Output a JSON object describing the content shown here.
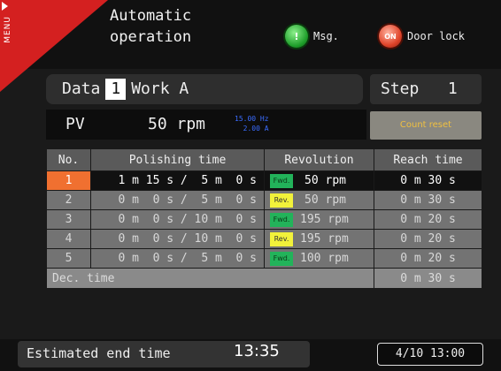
{
  "header": {
    "menu_label": "MENU",
    "title": "Automatic\noperation",
    "msg_button": {
      "icon": "!",
      "label": "Msg."
    },
    "door_button": {
      "icon": "ON",
      "label": "Door lock"
    }
  },
  "data_row": {
    "data_label": "Data",
    "data_number": "1",
    "work_label": "Work A"
  },
  "step": {
    "label": "Step",
    "value": "1"
  },
  "pv": {
    "label": "PV",
    "value": "50 rpm",
    "sub_line1": "15.00 Hz",
    "sub_line2": "2.00 A"
  },
  "count_reset_label": "Count reset",
  "table": {
    "headers": [
      "No.",
      "Polishing time",
      "Revolution",
      "Reach time"
    ],
    "rows": [
      {
        "no": "1",
        "polishing": "1 m 15 s /  5 m  0 s",
        "dir": "Fwd.",
        "rev": "50 rpm",
        "reach": "0 m 30 s"
      },
      {
        "no": "2",
        "polishing": "0 m  0 s /  5 m  0 s",
        "dir": "Rev.",
        "rev": "50 rpm",
        "reach": "0 m 30 s"
      },
      {
        "no": "3",
        "polishing": "0 m  0 s / 10 m  0 s",
        "dir": "Fwd.",
        "rev": "195 rpm",
        "reach": "0 m 20 s"
      },
      {
        "no": "4",
        "polishing": "0 m  0 s / 10 m  0 s",
        "dir": "Rev.",
        "rev": "195 rpm",
        "reach": "0 m 20 s"
      },
      {
        "no": "5",
        "polishing": "0 m  0 s /  5 m  0 s",
        "dir": "Fwd.",
        "rev": "100 rpm",
        "reach": "0 m 20 s"
      }
    ],
    "dec_label": "Dec. time",
    "dec_value": "0 m 30 s",
    "active_row": 1
  },
  "footer": {
    "est_label": "Estimated end time",
    "est_time": "13:35",
    "clock": "4/10 13:00"
  },
  "colors": {
    "active_row_number": "#f07030",
    "fwd_badge": "#22b35a",
    "rev_badge": "#f2f23a",
    "menu_corner": "#d42020"
  }
}
